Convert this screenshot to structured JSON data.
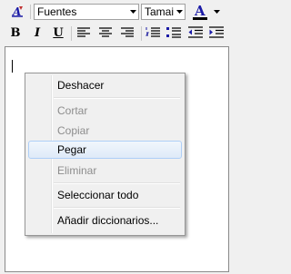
{
  "toolbar": {
    "font_family_value": "Fuentes",
    "font_size_value": "Tamai",
    "text_color_glyph": "A",
    "bold_glyph": "B",
    "italic_glyph": "I",
    "underline_glyph": "U",
    "icons": [
      "style-icon",
      "text-color-icon",
      "align-left-icon",
      "align-center-icon",
      "align-right-icon",
      "numbered-list-icon",
      "bulleted-list-icon",
      "outdent-icon",
      "indent-icon"
    ],
    "accent_color": "#1a1aa6"
  },
  "context_menu": {
    "items": [
      {
        "label": "Deshacer",
        "enabled": true
      },
      {
        "label": "Cortar",
        "enabled": false
      },
      {
        "label": "Copiar",
        "enabled": false
      },
      {
        "label": "Pegar",
        "enabled": true,
        "highlighted": true
      },
      {
        "label": "Eliminar",
        "enabled": false
      },
      {
        "label": "Seleccionar todo",
        "enabled": true
      },
      {
        "label": "Añadir diccionarios...",
        "enabled": true
      }
    ]
  }
}
